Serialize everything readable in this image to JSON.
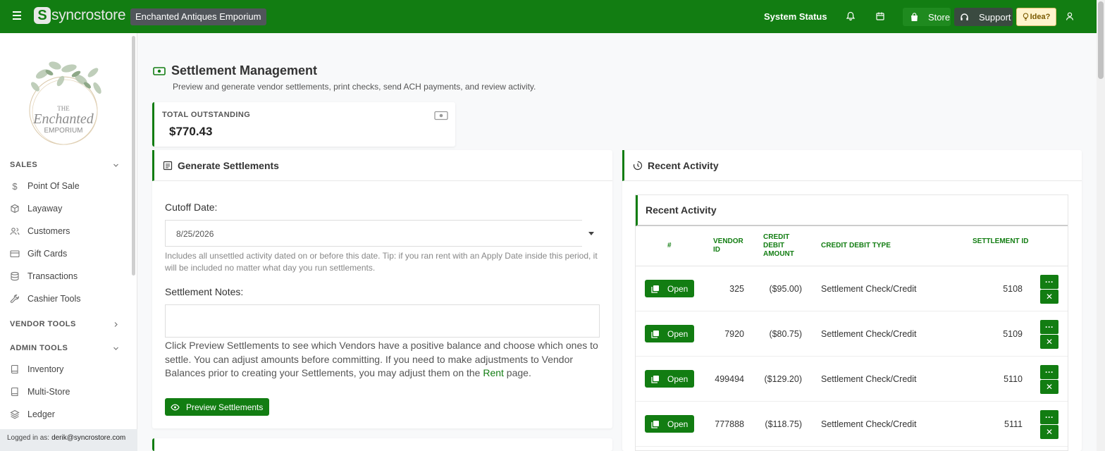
{
  "topbar": {
    "logo_text": "syncrostore",
    "logo_mark": "S",
    "store_name": "Enchanted Antiques Emporium",
    "system_status": "System Status",
    "store_label": "Store",
    "support_label": "Support",
    "idea_label": "Idea?",
    "bg_color": "#127d12"
  },
  "sidebar": {
    "sections": [
      {
        "label": "SALES",
        "items": [
          "Point Of Sale",
          "Layaway",
          "Customers",
          "Gift Cards",
          "Transactions",
          "Cashier Tools"
        ]
      },
      {
        "label": "VENDOR TOOLS",
        "items": []
      },
      {
        "label": "ADMIN TOOLS",
        "items": [
          "Inventory",
          "Multi-Store",
          "Ledger"
        ]
      }
    ],
    "logged_in_label": "Logged in as:",
    "logged_in_user": "derik@syncrostore.com"
  },
  "page": {
    "title": "Settlement Management",
    "subtitle": "Preview and generate vendor settlements, print checks, send ACH payments, and review activity."
  },
  "kpi": {
    "label": "TOTAL OUTSTANDING",
    "value": "$770.43"
  },
  "generate": {
    "title": "Generate Settlements",
    "cutoff_label": "Cutoff Date:",
    "cutoff_value": "8/25/2026",
    "cutoff_help": "Includes all unsettled activity dated on or before this date. Tip: if you ran rent with an Apply Date inside this period, it will be included no matter what day you run settlements.",
    "notes_label": "Settlement Notes:",
    "instructions_pre": "Click Preview Settlements to see which Vendors have a positive balance and choose which ones to settle. You can adjust amounts before committing. If you need to make adjustments to Vendor Balances prior to creating your Settlements, you may adjust them on the ",
    "instructions_link": "Rent",
    "instructions_post": " page.",
    "preview_button": "Preview Settlements"
  },
  "recent": {
    "title": "Recent Activity",
    "inner_title": "Recent Activity",
    "columns": [
      "#",
      "VENDOR ID",
      "CREDIT DEBIT AMOUNT",
      "CREDIT DEBIT TYPE",
      "SETTLEMENT ID"
    ],
    "open_label": "Open",
    "more_label": "···",
    "remove_label": "✕",
    "rows": [
      {
        "vendor_id": "325",
        "amount": "($95.00)",
        "type": "Settlement Check/Credit",
        "settlement_id": "5108"
      },
      {
        "vendor_id": "7920",
        "amount": "($80.75)",
        "type": "Settlement Check/Credit",
        "settlement_id": "5109"
      },
      {
        "vendor_id": "499494",
        "amount": "($129.20)",
        "type": "Settlement Check/Credit",
        "settlement_id": "5110"
      },
      {
        "vendor_id": "777888",
        "amount": "($118.75)",
        "type": "Settlement Check/Credit",
        "settlement_id": "5111"
      }
    ]
  }
}
